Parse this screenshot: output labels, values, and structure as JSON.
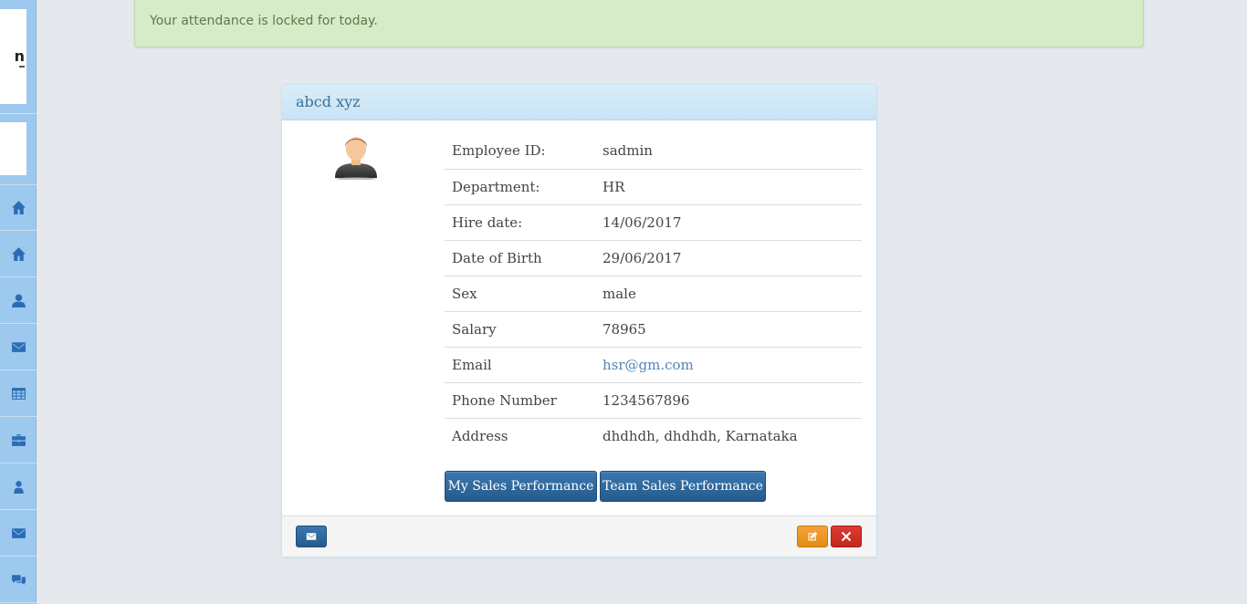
{
  "alert": {
    "message": "Your attendance is locked for today."
  },
  "sidebar": {
    "logo_text": "n",
    "items": [
      {
        "icon": "home-icon"
      },
      {
        "icon": "home-icon"
      },
      {
        "icon": "user-icon"
      },
      {
        "icon": "envelope-icon"
      },
      {
        "icon": "table-icon"
      },
      {
        "icon": "briefcase-icon"
      },
      {
        "icon": "user-icon"
      },
      {
        "icon": "envelope-icon"
      },
      {
        "icon": "comments-icon"
      }
    ]
  },
  "profile": {
    "name": "abcd xyz",
    "fields": [
      {
        "label": "Employee ID:",
        "value": "sadmin"
      },
      {
        "label": "Department:",
        "value": "HR"
      },
      {
        "label": "Hire date:",
        "value": "14/06/2017"
      },
      {
        "label": "Date of Birth",
        "value": "29/06/2017"
      },
      {
        "label": "Sex",
        "value": "male"
      },
      {
        "label": "Salary",
        "value": "78965"
      },
      {
        "label": "Email",
        "value": "hsr@gm.com"
      },
      {
        "label": "Phone Number",
        "value": "1234567896"
      },
      {
        "label": "Address",
        "value": "dhdhdh, dhdhdh, Karnataka"
      }
    ],
    "buttons": {
      "my_sales": "My Sales Performance",
      "team_sales": "Team Sales Performance"
    }
  },
  "colors": {
    "sidebar": "#9ec9ee",
    "alert_bg": "#d6ecc8",
    "primary": "#2f6ba0",
    "warning": "#f0a030",
    "danger": "#d0342c"
  }
}
